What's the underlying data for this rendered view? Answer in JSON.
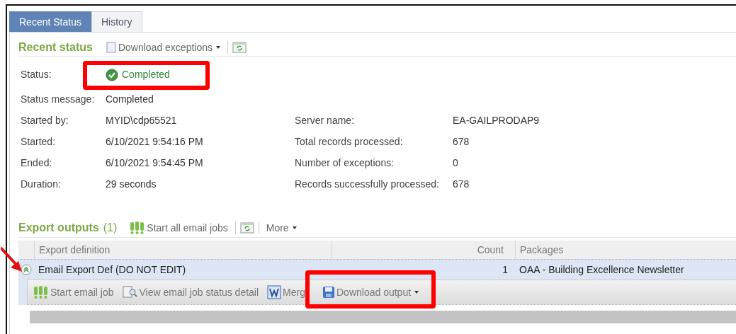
{
  "tabs": [
    {
      "label": "Recent Status",
      "selected": true
    },
    {
      "label": "History",
      "selected": false
    }
  ],
  "recent_status": {
    "title": "Recent status",
    "toolbar": [
      {
        "kind": "download",
        "label": "Download exceptions",
        "dropdown": true
      },
      {
        "kind": "refresh"
      }
    ],
    "rows": [
      {
        "label": "Status:",
        "value": "Completed",
        "kind": "status"
      },
      {
        "label": "Status message:",
        "value": "Completed",
        "kind": "text"
      },
      {
        "label": "Started by:",
        "value": "MYID\\cdp65521",
        "kind": "text",
        "label_2": "Server name:",
        "value_2": "EA-GAILPRODAP9"
      },
      {
        "label": "Started:",
        "value": "6/10/2021 9:54:16 PM",
        "kind": "text",
        "label_2": "Total records processed:",
        "value_2": "678"
      },
      {
        "label": "Ended:",
        "value": "6/10/2021 9:54:45 PM",
        "kind": "text",
        "label_2": "Number of exceptions:",
        "value_2": "0"
      },
      {
        "label": "Duration:",
        "value": "29 seconds",
        "kind": "text",
        "label_2": "Records successfully processed:",
        "value_2": "678"
      }
    ]
  },
  "export_outputs": {
    "title": "Export outputs",
    "count": "(1)",
    "toolbar": [
      {
        "kind": "email",
        "label": "Start all email jobs"
      },
      {
        "kind": "refresh"
      },
      {
        "kind": "more",
        "label": "More",
        "dropdown": true
      }
    ],
    "columns": [
      "Export definition",
      "Count",
      "Packages"
    ],
    "rows": [
      {
        "expanded": true,
        "selected": true,
        "cells": [
          "Email Export Def (DO NOT EDIT)",
          "1",
          "OAA - Building Excellence Newsletter"
        ],
        "actions": [
          {
            "kind": "email",
            "label": "Start email job"
          },
          {
            "kind": "view",
            "label": "View email job status detail"
          },
          {
            "kind": "word",
            "label": "Merg"
          },
          {
            "kind": "save",
            "label": "Download output",
            "dropdown": true,
            "highlighted": true
          }
        ]
      }
    ]
  }
}
